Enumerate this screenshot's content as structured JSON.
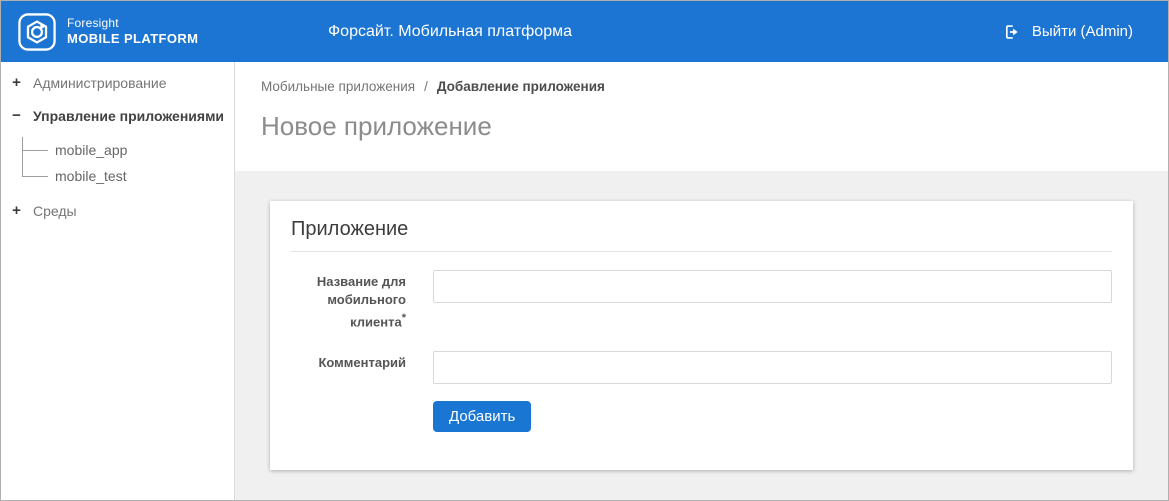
{
  "header": {
    "logo_line1": "Foresight",
    "logo_line2": "MOBILE PLATFORM",
    "title": "Форсайт. Мобильная платформа",
    "logout_label": "Выйти (Admin)",
    "bg_color": "#1c75d3"
  },
  "sidebar": {
    "expand_icon": "+",
    "collapse_icon": "−",
    "items": [
      {
        "label": "Администрирование",
        "state": "collapsed"
      },
      {
        "label": "Управление приложениями",
        "state": "expanded",
        "children": [
          "mobile_app",
          "mobile_test"
        ]
      },
      {
        "label": "Среды",
        "state": "collapsed"
      }
    ]
  },
  "breadcrumb": {
    "parent": "Мобильные приложения",
    "separator": "/",
    "current": "Добавление приложения"
  },
  "page": {
    "title": "Новое приложение"
  },
  "form": {
    "section_title": "Приложение",
    "required_marker": "*",
    "fields": [
      {
        "label": "Название для мобильного клиента",
        "required": true,
        "value": ""
      },
      {
        "label": "Комментарий",
        "required": false,
        "value": ""
      }
    ],
    "submit_label": "Добавить",
    "submit_color": "#1976d2"
  }
}
